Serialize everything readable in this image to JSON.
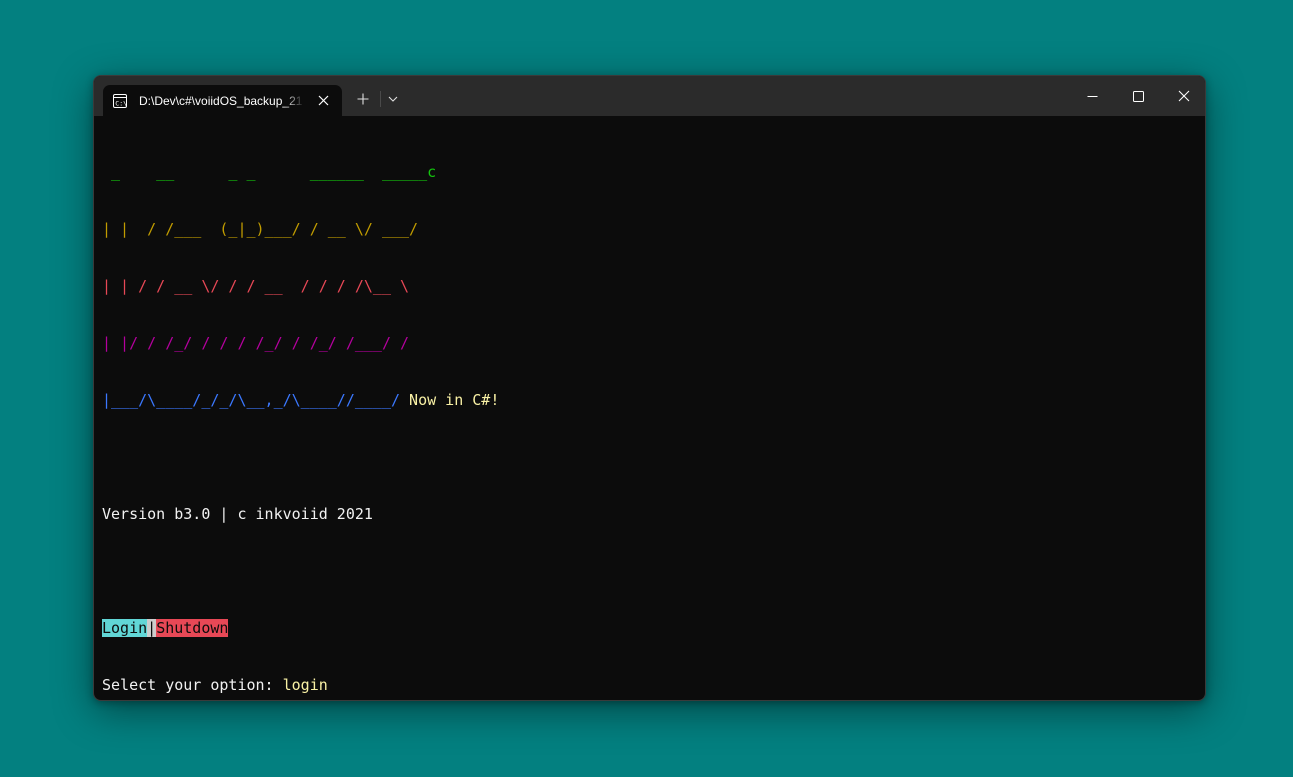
{
  "window": {
    "tab_title": "D:\\Dev\\c#\\voiidOS_backup_21",
    "icons": {
      "tab": "terminal-icon",
      "close_tab": "close-icon",
      "new_tab": "plus-icon",
      "dropdown": "chevron-down-icon",
      "minimize": "minimize-icon",
      "maximize": "maximize-icon",
      "close_window": "close-icon"
    }
  },
  "terminal": {
    "ascii": [
      " _    __      _ _      ______  _____c",
      "| |  / /___  (_|_)___/ / __ \\/ ___/",
      "| | / / __ \\/ / / __  / / / /\\__ \\",
      "| |/ / /_/ / / / /_/ / /_/ /___/ /",
      "|___/\\____/_/_/\\__,_/\\____//____/"
    ],
    "tagline": " Now in C#!",
    "version": "Version b3.0 | c inkvoiid 2021",
    "menu": {
      "login": "Login",
      "separator": "|",
      "shutdown": "Shutdown"
    },
    "prompt": "Select your option: ",
    "input": "login"
  },
  "colors": {
    "desktop": "#038080",
    "terminal_bg": "#0c0c0c",
    "ascii_line1": "#13c40d",
    "ascii_line2": "#c19c00",
    "ascii_line3": "#e74856",
    "ascii_line4": "#b4009e",
    "ascii_line5": "#3b78ff",
    "tagline": "#f9f1a5",
    "login_bg": "#61d6d6",
    "shutdown_bg": "#e74856"
  }
}
